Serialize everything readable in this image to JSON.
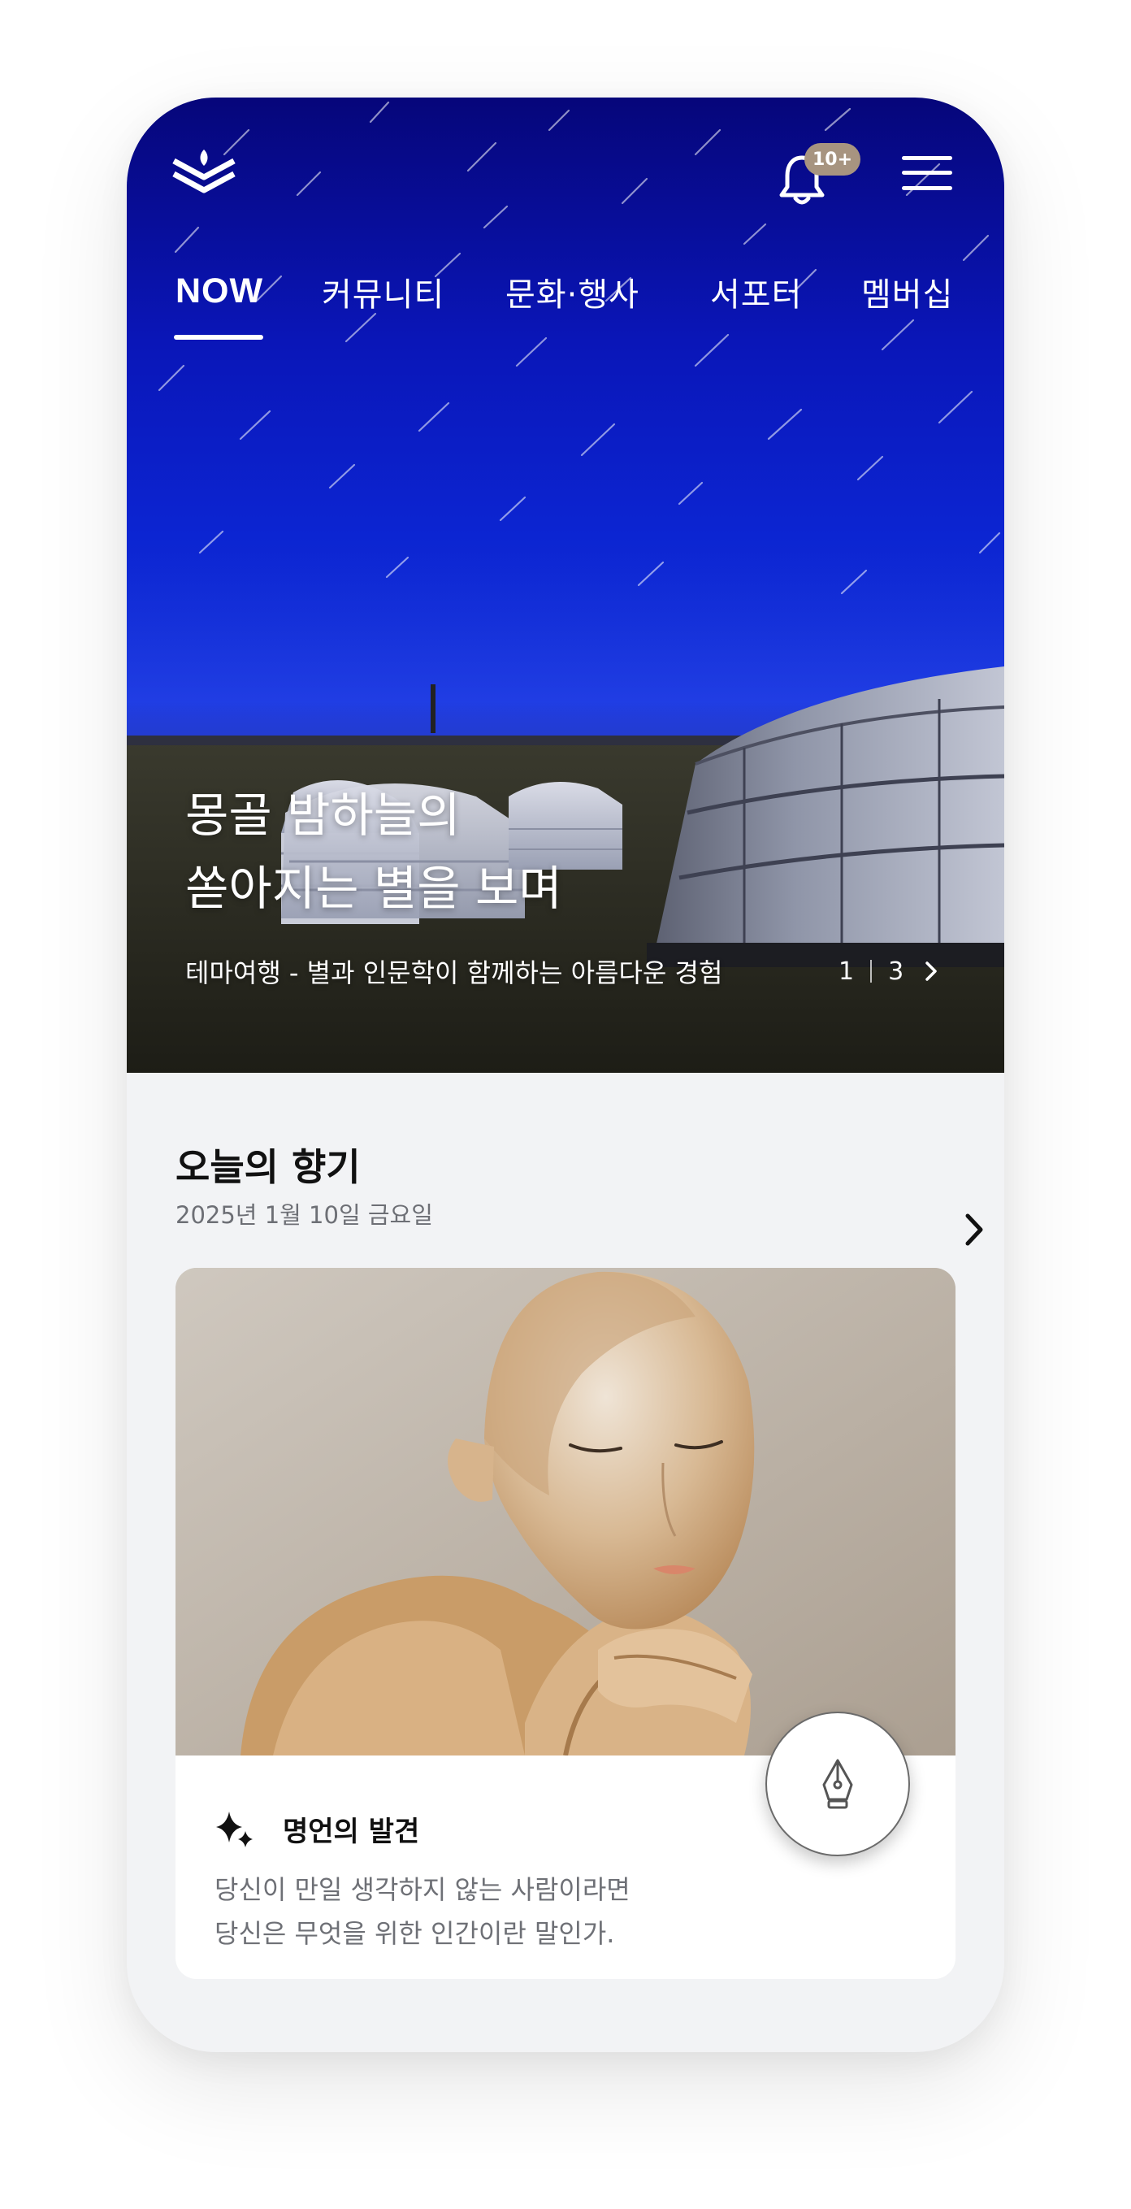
{
  "header": {
    "logo_icon": "layered-chevron-logo-icon",
    "notification_badge": "10+",
    "bell_icon": "bell-icon",
    "menu_icon": "hamburger-menu-icon"
  },
  "nav": {
    "tabs": [
      {
        "label": "NOW",
        "active": true
      },
      {
        "label": "커뮤니티",
        "active": false
      },
      {
        "label": "문화·행사",
        "active": false
      },
      {
        "label": "서포터",
        "active": false
      },
      {
        "label": "멤버십",
        "active": false
      }
    ]
  },
  "hero": {
    "title_line1": "몽골 밤하늘의",
    "title_line2": "쏟아지는 별을 보며",
    "subtitle": "테마여행 - 별과 인문학이 함께하는 아름다운 경험",
    "pager_current": "1",
    "pager_total": "3"
  },
  "today": {
    "title": "오늘의 향기",
    "date": "2025년 1월 10일 금요일",
    "card": {
      "label": "명언의 발견",
      "quote_line1": "당신이 만일 생각하지 않는 사람이라면",
      "quote_line2": "당신은 무엇을 위한 인간이란 말인가.",
      "icon": "sparkle-icon",
      "fab_icon": "fountain-pen-icon"
    }
  },
  "colors": {
    "sky_top": "#06067a",
    "sky_mid": "#0c25d2",
    "badge": "#a79480",
    "page_bg": "#f2f3f5",
    "card_bg": "#ffffff"
  }
}
